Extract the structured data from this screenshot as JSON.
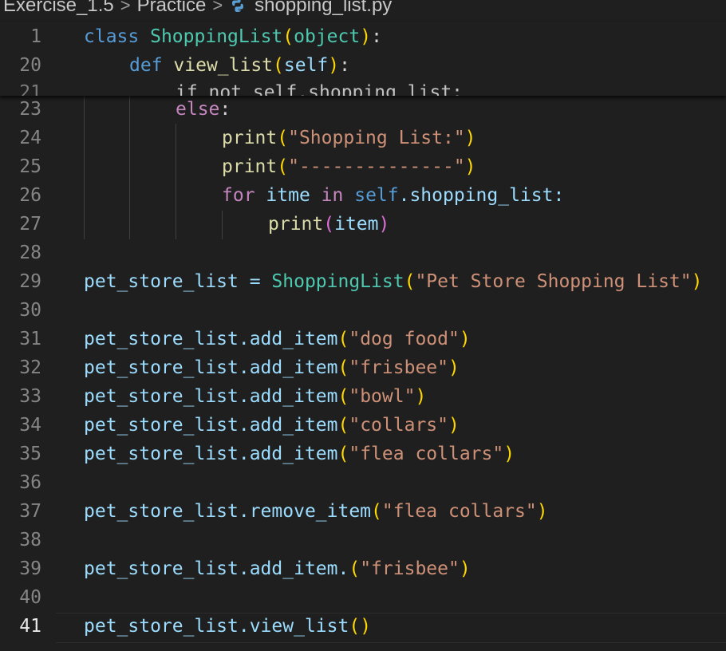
{
  "breadcrumb": {
    "folder": "Exercise_1.5",
    "subfolder": "Practice",
    "file": "shopping_list.py",
    "separator": ">"
  },
  "sticky_scroll": [
    {
      "num": "1",
      "parts": {
        "kw": "class",
        "name": "ShoppingList",
        "open": "(",
        "base": "object",
        "close": ")",
        "colon": ":"
      }
    },
    {
      "num": "20",
      "parts": {
        "kw": "def",
        "name": "view_list",
        "open": "(",
        "self": "self",
        "close": ")",
        "colon": ":"
      }
    },
    {
      "num": "21",
      "text": "if not self.shopping_list:"
    }
  ],
  "lines": [
    {
      "num": "23",
      "kw": "else",
      "rest": ":"
    },
    {
      "num": "24",
      "fn": "print",
      "arg": "\"Shopping List:\""
    },
    {
      "num": "25",
      "fn": "print",
      "arg": "\"--------------\""
    },
    {
      "num": "26",
      "kw1": "for",
      "var": "itme",
      "kw2": "in",
      "self": "self",
      "rest": ".shopping_list:"
    },
    {
      "num": "27",
      "fn": "print",
      "arg": "item"
    },
    {
      "num": "28"
    },
    {
      "num": "29",
      "lhs": "pet_store_list = ",
      "cls": "ShoppingList",
      "arg": "\"Pet Store Shopping List\""
    },
    {
      "num": "30"
    },
    {
      "num": "31",
      "obj": "pet_store_list.add_item",
      "arg": "\"dog food\""
    },
    {
      "num": "32",
      "obj": "pet_store_list.add_item",
      "arg": "\"frisbee\""
    },
    {
      "num": "33",
      "obj": "pet_store_list.add_item",
      "arg": "\"bowl\""
    },
    {
      "num": "34",
      "obj": "pet_store_list.add_item",
      "arg": "\"collars\""
    },
    {
      "num": "35",
      "obj": "pet_store_list.add_item",
      "arg": "\"flea collars\""
    },
    {
      "num": "36"
    },
    {
      "num": "37",
      "obj": "pet_store_list.remove_item",
      "arg": "\"flea collars\""
    },
    {
      "num": "38"
    },
    {
      "num": "39",
      "obj": "pet_store_list.add_item.",
      "arg": "\"frisbee\""
    },
    {
      "num": "40"
    },
    {
      "num": "41",
      "obj": "pet_store_list.view_list",
      "arg": ""
    }
  ],
  "colors": {
    "background": "#1f1f1f",
    "keyword": "#569cd6",
    "control_keyword": "#c586c0",
    "class_name": "#4ec9b0",
    "function": "#dcdcaa",
    "string": "#ce9178",
    "variable": "#9cdcfe",
    "bracket": "#ffd700"
  },
  "icons": {
    "file_icon": "python-icon"
  }
}
